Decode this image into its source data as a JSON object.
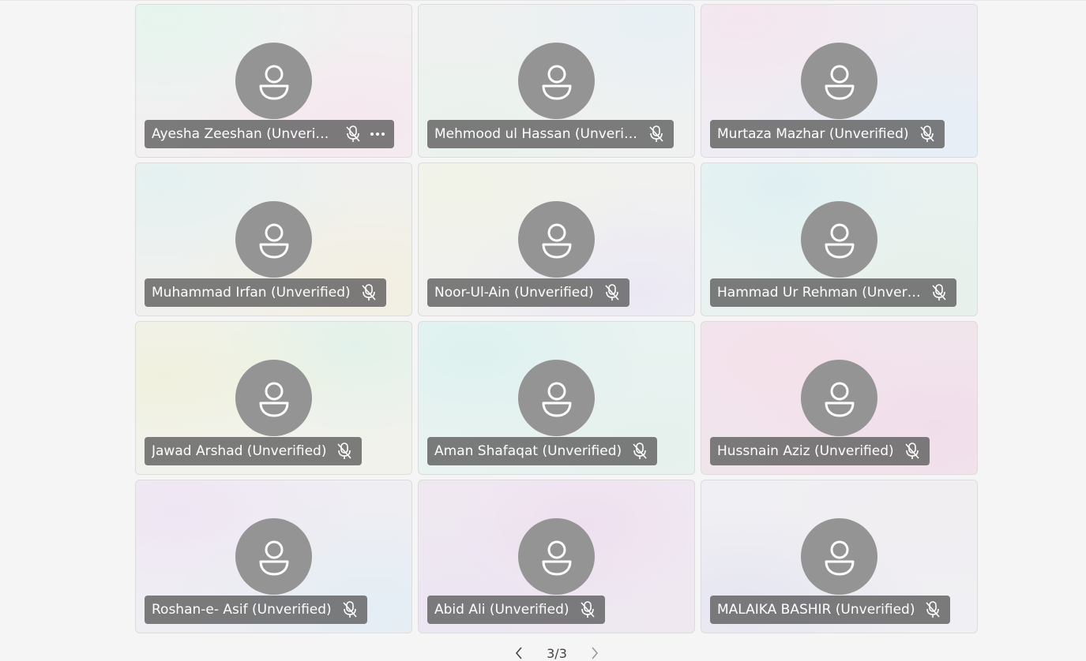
{
  "participants": [
    {
      "name": "Ayesha Zeeshan (Unverified)",
      "muted": true,
      "has_more": true
    },
    {
      "name": "Mehmood ul Hassan (Unverified)",
      "muted": true,
      "has_more": false
    },
    {
      "name": "Murtaza Mazhar (Unverified)",
      "muted": true,
      "has_more": false
    },
    {
      "name": "Muhammad Irfan (Unverified)",
      "muted": true,
      "has_more": false
    },
    {
      "name": "Noor-Ul-Ain (Unverified)",
      "muted": true,
      "has_more": false
    },
    {
      "name": "Hammad Ur Rehman (Unverified)",
      "muted": true,
      "has_more": false
    },
    {
      "name": "Jawad Arshad (Unverified)",
      "muted": true,
      "has_more": false
    },
    {
      "name": "Aman Shafaqat (Unverified)",
      "muted": true,
      "has_more": false
    },
    {
      "name": "Hussnain Aziz (Unverified)",
      "muted": true,
      "has_more": false
    },
    {
      "name": "Roshan-e- Asif (Unverified)",
      "muted": true,
      "has_more": false
    },
    {
      "name": "Abid Ali (Unverified)",
      "muted": true,
      "has_more": false
    },
    {
      "name": "MALAIKA BASHIR (Unverified)",
      "muted": true,
      "has_more": false
    }
  ],
  "pagination": {
    "label": "3/3",
    "prev_icon": "chevron-left-icon",
    "next_icon": "chevron-right-icon"
  },
  "icons": {
    "avatar": "person-icon",
    "mic": "mic-off-icon",
    "more": "more-options-icon"
  },
  "colors": {
    "page_background": "#f5f5f5",
    "avatar": "#949494",
    "name_pill": "#606060",
    "text": "#ffffff"
  }
}
